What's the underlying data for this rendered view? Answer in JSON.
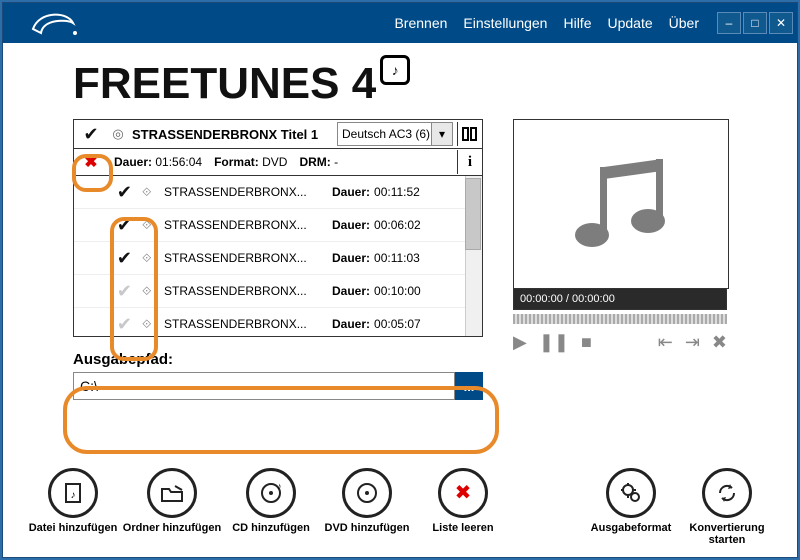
{
  "menu": {
    "brennen": "Brennen",
    "einstellungen": "Einstellungen",
    "hilfe": "Hilfe",
    "update": "Update",
    "uber": "Über"
  },
  "app_title": "FREETUNES 4",
  "header": {
    "title": "STRASSENDERBRONX Titel 1",
    "audio_track": "Deutsch AC3 (6)"
  },
  "info": {
    "dauer_label": "Dauer:",
    "dauer": "01:56:04",
    "format_label": "Format:",
    "format": "DVD",
    "drm_label": "DRM:",
    "drm": "-"
  },
  "tracks": [
    {
      "name": "STRASSENDERBRONX...",
      "dur_label": "Dauer:",
      "dur": "00:11:52",
      "checked": true
    },
    {
      "name": "STRASSENDERBRONX...",
      "dur_label": "Dauer:",
      "dur": "00:06:02",
      "checked": true
    },
    {
      "name": "STRASSENDERBRONX...",
      "dur_label": "Dauer:",
      "dur": "00:11:03",
      "checked": true
    },
    {
      "name": "STRASSENDERBRONX...",
      "dur_label": "Dauer:",
      "dur": "00:10:00",
      "checked": false
    },
    {
      "name": "STRASSENDERBRONX...",
      "dur_label": "Dauer:",
      "dur": "00:05:07",
      "checked": false
    }
  ],
  "output": {
    "label": "Ausgabepfad:",
    "path": "C:\\",
    "browse": "..."
  },
  "preview": {
    "time": "00:00:00 / 00:00:00"
  },
  "toolbar": {
    "file": "Datei hinzufügen",
    "folder": "Ordner hinzufügen",
    "cd": "CD hinzufügen",
    "dvd": "DVD hinzufügen",
    "clear": "Liste leeren",
    "format": "Ausgabeformat",
    "convert": "Konvertierung\nstarten"
  }
}
